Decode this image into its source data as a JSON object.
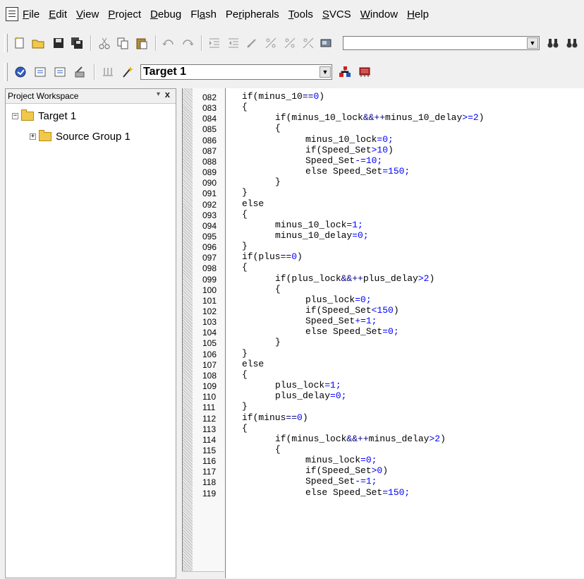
{
  "menu": {
    "items": [
      {
        "accel": "F",
        "rest": "ile"
      },
      {
        "accel": "E",
        "rest": "dit"
      },
      {
        "accel": "V",
        "rest": "iew"
      },
      {
        "accel": "P",
        "rest": "roject"
      },
      {
        "accel": "D",
        "rest": "ebug"
      },
      {
        "pre": "Fl",
        "accel": "a",
        "rest": "sh"
      },
      {
        "pre": "Pe",
        "accel": "r",
        "rest": "ipherals"
      },
      {
        "accel": "T",
        "rest": "ools"
      },
      {
        "accel": "S",
        "rest": "VCS"
      },
      {
        "accel": "W",
        "rest": "indow"
      },
      {
        "accel": "H",
        "rest": "elp"
      }
    ]
  },
  "toolbar": {
    "target_value": "Target 1",
    "find_value": ""
  },
  "project": {
    "title": "Project Workspace",
    "pin_glyph": "▾",
    "close_glyph": "x",
    "tree": {
      "root": {
        "label": "Target 1",
        "expander": "−"
      },
      "child": {
        "label": "Source Group 1",
        "expander": "+"
      }
    }
  },
  "colors": {
    "keyword": "#000080",
    "literal": "#0000ff",
    "text": "#000000"
  },
  "editor": {
    "lines": [
      {
        "n": "082",
        "indent": 1,
        "segs": [
          [
            "if(minus_10",
            "t"
          ],
          [
            "==",
            "o"
          ],
          [
            "0",
            "n"
          ],
          [
            ")",
            "t"
          ]
        ]
      },
      {
        "n": "083",
        "indent": 1,
        "segs": [
          [
            "{",
            "t"
          ]
        ]
      },
      {
        "n": "084",
        "indent": 2,
        "segs": [
          [
            "if(minus_10_lock",
            "t"
          ],
          [
            "&&++",
            "o"
          ],
          [
            "minus_10_delay",
            "t"
          ],
          [
            ">=2",
            "n"
          ],
          [
            ")",
            "t"
          ]
        ]
      },
      {
        "n": "085",
        "indent": 2,
        "segs": [
          [
            "{",
            "t"
          ]
        ]
      },
      {
        "n": "086",
        "indent": 3,
        "segs": [
          [
            "minus_10_lock",
            "t"
          ],
          [
            "=0;",
            "n"
          ]
        ]
      },
      {
        "n": "087",
        "indent": 3,
        "segs": [
          [
            "if(Speed_Set",
            "t"
          ],
          [
            ">10",
            "n"
          ],
          [
            ")",
            "t"
          ]
        ]
      },
      {
        "n": "088",
        "indent": 3,
        "segs": [
          [
            "Speed_Set",
            "t"
          ],
          [
            "-=10;",
            "n"
          ]
        ]
      },
      {
        "n": "089",
        "indent": 3,
        "segs": [
          [
            "else Speed_Set",
            "t"
          ],
          [
            "=150;",
            "n"
          ]
        ]
      },
      {
        "n": "090",
        "indent": 2,
        "segs": [
          [
            "}",
            "t"
          ]
        ]
      },
      {
        "n": "091",
        "indent": 1,
        "segs": [
          [
            "}",
            "t"
          ]
        ]
      },
      {
        "n": "092",
        "indent": 1,
        "segs": [
          [
            "else",
            "t"
          ]
        ]
      },
      {
        "n": "093",
        "indent": 1,
        "segs": [
          [
            "{",
            "t"
          ]
        ]
      },
      {
        "n": "094",
        "indent": 2,
        "segs": [
          [
            "minus_10_lock",
            "t"
          ],
          [
            "=1;",
            "n"
          ]
        ]
      },
      {
        "n": "095",
        "indent": 2,
        "segs": [
          [
            "minus_10_delay",
            "t"
          ],
          [
            "=0;",
            "n"
          ]
        ]
      },
      {
        "n": "096",
        "indent": 1,
        "segs": [
          [
            "}",
            "t"
          ]
        ]
      },
      {
        "n": "097",
        "indent": 1,
        "segs": [
          [
            "if(plus",
            "t"
          ],
          [
            "==",
            "o"
          ],
          [
            "0",
            "n"
          ],
          [
            ")",
            "t"
          ]
        ]
      },
      {
        "n": "098",
        "indent": 1,
        "segs": [
          [
            "{",
            "t"
          ]
        ]
      },
      {
        "n": "099",
        "indent": 2,
        "segs": [
          [
            "if(plus_lock",
            "t"
          ],
          [
            "&&++",
            "o"
          ],
          [
            "plus_delay",
            "t"
          ],
          [
            ">2",
            "n"
          ],
          [
            ")",
            "t"
          ]
        ]
      },
      {
        "n": "100",
        "indent": 2,
        "segs": [
          [
            "{",
            "t"
          ]
        ]
      },
      {
        "n": "101",
        "indent": 3,
        "segs": [
          [
            "plus_lock",
            "t"
          ],
          [
            "=0;",
            "n"
          ]
        ]
      },
      {
        "n": "102",
        "indent": 3,
        "segs": [
          [
            "if(Speed_Set",
            "t"
          ],
          [
            "<150",
            "n"
          ],
          [
            ")",
            "t"
          ]
        ]
      },
      {
        "n": "103",
        "indent": 3,
        "segs": [
          [
            "Speed_Set",
            "t"
          ],
          [
            "+=1;",
            "n"
          ]
        ]
      },
      {
        "n": "104",
        "indent": 3,
        "segs": [
          [
            "else Speed_Set",
            "t"
          ],
          [
            "=0;",
            "n"
          ]
        ]
      },
      {
        "n": "105",
        "indent": 2,
        "segs": [
          [
            "}",
            "t"
          ]
        ]
      },
      {
        "n": "106",
        "indent": 1,
        "segs": [
          [
            "}",
            "t"
          ]
        ]
      },
      {
        "n": "107",
        "indent": 1,
        "segs": [
          [
            "else",
            "t"
          ]
        ]
      },
      {
        "n": "108",
        "indent": 1,
        "segs": [
          [
            "{",
            "t"
          ]
        ]
      },
      {
        "n": "109",
        "indent": 2,
        "segs": [
          [
            "plus_lock",
            "t"
          ],
          [
            "=1;",
            "n"
          ]
        ]
      },
      {
        "n": "110",
        "indent": 2,
        "segs": [
          [
            "plus_delay",
            "t"
          ],
          [
            "=0;",
            "n"
          ]
        ]
      },
      {
        "n": "111",
        "indent": 1,
        "segs": [
          [
            "}",
            "t"
          ]
        ]
      },
      {
        "n": "112",
        "indent": 1,
        "segs": [
          [
            "if(minus",
            "t"
          ],
          [
            "==",
            "o"
          ],
          [
            "0",
            "n"
          ],
          [
            ")",
            "t"
          ]
        ]
      },
      {
        "n": "113",
        "indent": 1,
        "segs": [
          [
            "{",
            "t"
          ]
        ]
      },
      {
        "n": "114",
        "indent": 2,
        "segs": [
          [
            "if(minus_lock",
            "t"
          ],
          [
            "&&++",
            "o"
          ],
          [
            "minus_delay",
            "t"
          ],
          [
            ">2",
            "n"
          ],
          [
            ")",
            "t"
          ]
        ]
      },
      {
        "n": "115",
        "indent": 2,
        "segs": [
          [
            "{",
            "t"
          ]
        ]
      },
      {
        "n": "116",
        "indent": 3,
        "segs": [
          [
            "minus_lock",
            "t"
          ],
          [
            "=0;",
            "n"
          ]
        ]
      },
      {
        "n": "117",
        "indent": 3,
        "segs": [
          [
            "if(Speed_Set",
            "t"
          ],
          [
            ">0",
            "n"
          ],
          [
            ")",
            "t"
          ]
        ]
      },
      {
        "n": "118",
        "indent": 3,
        "segs": [
          [
            "Speed_Set",
            "t"
          ],
          [
            "-=1;",
            "n"
          ]
        ]
      },
      {
        "n": "119",
        "indent": 3,
        "segs": [
          [
            "else Speed_Set",
            "t"
          ],
          [
            "=150;",
            "n"
          ]
        ]
      }
    ]
  }
}
